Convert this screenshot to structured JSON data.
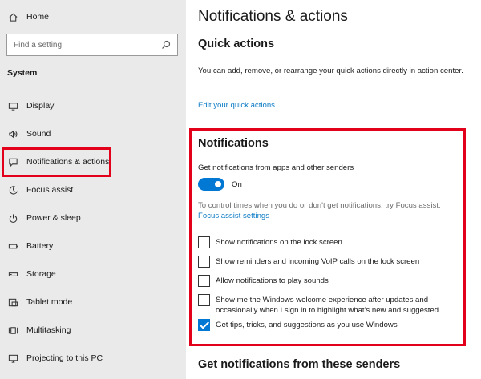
{
  "sidebar": {
    "home_label": "Home",
    "search_placeholder": "Find a setting",
    "section_label": "System",
    "items": [
      {
        "label": "Display",
        "icon": "monitor-icon"
      },
      {
        "label": "Sound",
        "icon": "speaker-icon"
      },
      {
        "label": "Notifications & actions",
        "icon": "message-icon",
        "selected": true
      },
      {
        "label": "Focus assist",
        "icon": "moon-icon"
      },
      {
        "label": "Power & sleep",
        "icon": "power-icon"
      },
      {
        "label": "Battery",
        "icon": "battery-icon"
      },
      {
        "label": "Storage",
        "icon": "storage-icon"
      },
      {
        "label": "Tablet mode",
        "icon": "tablet-icon"
      },
      {
        "label": "Multitasking",
        "icon": "multitasking-icon"
      },
      {
        "label": "Projecting to this PC",
        "icon": "projector-icon"
      }
    ]
  },
  "main": {
    "page_title": "Notifications & actions",
    "quick_actions": {
      "title": "Quick actions",
      "description": "You can add, remove, or rearrange your quick actions directly in action center.",
      "edit_link": "Edit your quick actions"
    },
    "notifications": {
      "title": "Notifications",
      "senders_label": "Get notifications from apps and other senders",
      "toggle_state": "On",
      "focus_text": "To control times when you do or don't get notifications, try Focus assist.",
      "focus_link": "Focus assist settings",
      "checkboxes": [
        {
          "label": "Show notifications on the lock screen",
          "checked": false
        },
        {
          "label": "Show reminders and incoming VoIP calls on the lock screen",
          "checked": false
        },
        {
          "label": "Allow notifications to play sounds",
          "checked": false
        },
        {
          "label": "Show me the Windows welcome experience after updates and occasionally when I sign in to highlight what's new and suggested",
          "checked": false
        },
        {
          "label": "Get tips, tricks, and suggestions as you use Windows",
          "checked": true
        }
      ]
    },
    "bottom_title": "Get notifications from these senders"
  },
  "colors": {
    "accent": "#0078d4",
    "link": "#0a7ac4",
    "highlight": "#e3001b",
    "sidebar_bg": "#eaeaea"
  }
}
